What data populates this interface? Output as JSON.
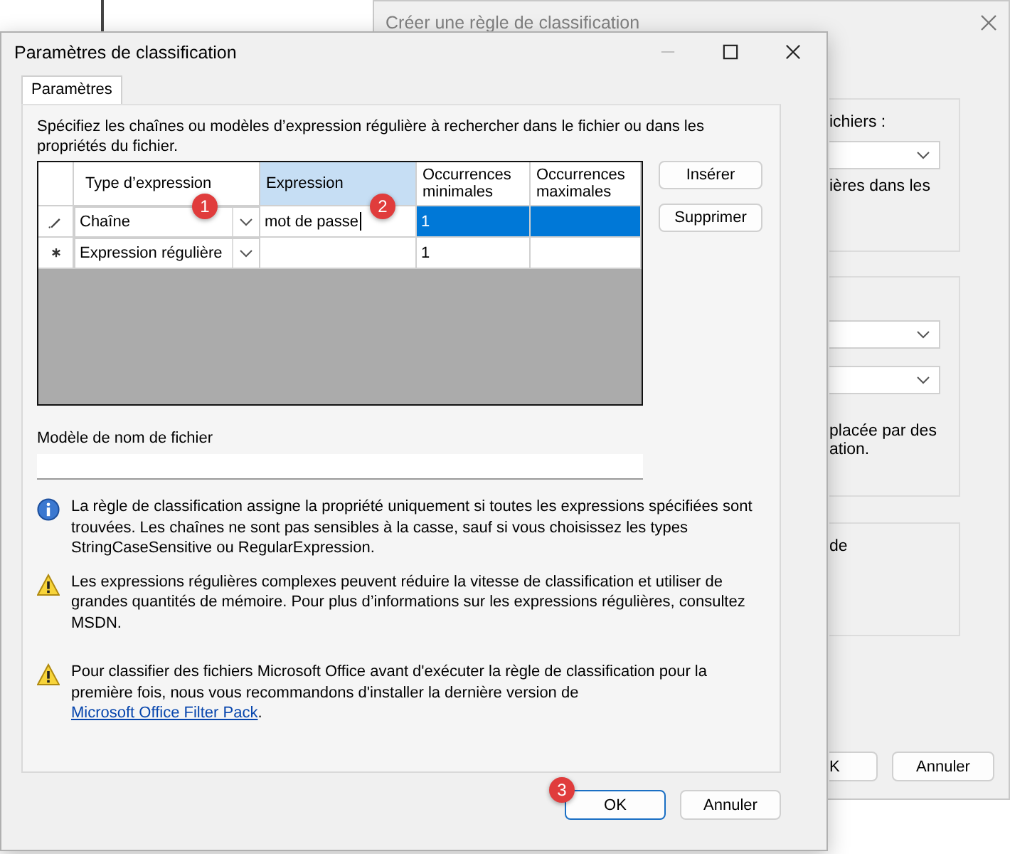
{
  "back_window": {
    "title": "Créer une règle de classification",
    "fragments": [
      {
        "items": [
          {
            "kind": "text",
            "text": "ichiers :"
          },
          {
            "kind": "dropdown"
          },
          {
            "kind": "text",
            "text": "ières dans les"
          }
        ]
      },
      {
        "items": [
          {
            "kind": "dropdown"
          },
          {
            "kind": "dropdown"
          },
          {
            "kind": "text",
            "text": "placée par des"
          },
          {
            "kind": "text",
            "text": "ation."
          }
        ]
      },
      {
        "items": [
          {
            "kind": "text",
            "text": "de"
          }
        ]
      }
    ],
    "buttons": [
      "K",
      "Annuler"
    ]
  },
  "dialog": {
    "title": "Paramètres de classification",
    "minimize_disabled": true,
    "tabs": [
      {
        "label": "Paramètres",
        "selected": true
      }
    ],
    "description": "Spécifiez les chaînes ou modèles d’expression régulière à rechercher dans le fichier ou dans les propriétés du fichier.",
    "grid": {
      "columns": [
        {
          "label": "Type d’expression",
          "selected": false
        },
        {
          "label": "Expression",
          "selected": true
        },
        {
          "label": "Occurrences minimales",
          "selected": false
        },
        {
          "label": "Occurrences maximales",
          "selected": false
        }
      ],
      "rows": [
        {
          "kind": "editing",
          "selected": true,
          "type": "Chaîne",
          "type_badge": "1",
          "expression": "mot de passe",
          "expression_badge": "2",
          "editing": true,
          "min": "1",
          "max": ""
        },
        {
          "kind": "new",
          "selected": false,
          "type": "Expression régulière",
          "expression": "",
          "editing": false,
          "min": "1",
          "max": ""
        }
      ]
    },
    "side_buttons": [
      "Insérer",
      "Supprimer"
    ],
    "filename_label": "Modèle de nom de fichier",
    "notes": [
      {
        "kind": "info",
        "text": "La règle de classification assigne la propriété uniquement si toutes les expressions spécifiées sont trouvées. Les chaînes ne sont pas sensibles à la casse, sauf si vous choisissez les types StringCaseSensitive ou RegularExpression."
      },
      {
        "kind": "warning",
        "text": "Les expressions régulières complexes peuvent réduire la vitesse de classification et utiliser de grandes quantités de mémoire. Pour plus d’informations sur les expressions régulières, consultez MSDN."
      },
      {
        "kind": "warning",
        "text": "Pour classifier des fichiers Microsoft Office avant d'exécuter la règle de classification pour la première fois, nous vous recommandons d'installer la dernière version de ",
        "link": "Microsoft Office Filter Pack",
        "after": "."
      }
    ],
    "buttons": [
      {
        "label": "OK",
        "default": true,
        "badge": "3"
      },
      {
        "label": "Annuler",
        "default": false
      }
    ]
  }
}
